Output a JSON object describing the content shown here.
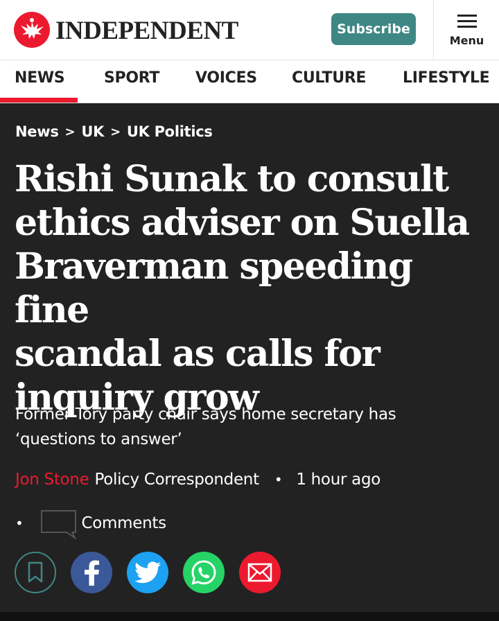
{
  "header": {
    "logo_text": "INDEPENDENT",
    "subscribe_label": "Subscribe",
    "menu_label": "Menu"
  },
  "nav": {
    "items": [
      {
        "label": "NEWS",
        "active": true
      },
      {
        "label": "SPORT"
      },
      {
        "label": "VOICES"
      },
      {
        "label": "CULTURE"
      },
      {
        "label": "LIFESTYLE"
      }
    ]
  },
  "breadcrumb": {
    "items": [
      "News",
      "UK",
      "UK Politics"
    ],
    "separator": ">"
  },
  "article": {
    "headline_lines": [
      "Rishi Sunak to consult",
      "ethics adviser on Suella",
      "Braverman speeding fine",
      "scandal as calls for",
      "inquiry grow"
    ],
    "standfirst_lines": [
      "Former Tory party chair says home secretary has",
      "‘questions to answer’"
    ],
    "author": "Jon Stone",
    "author_role": "Policy Correspondent",
    "timestamp": "1 hour ago",
    "comments_label": "Comments",
    "bullet": "•"
  },
  "share": {
    "buttons": [
      "bookmark",
      "facebook",
      "twitter",
      "whatsapp",
      "email"
    ]
  },
  "colors": {
    "accent_red": "#ec1a2e",
    "subscribe_teal": "#3f8784",
    "article_bg": "#222222",
    "facebook": "#3b5998",
    "twitter": "#1da1f2",
    "whatsapp": "#25d366"
  },
  "icons": {
    "logo": "eagle-logo-icon",
    "menu": "hamburger-icon",
    "comment": "comment-bubble-icon",
    "bookmark": "bookmark-icon",
    "facebook": "facebook-icon",
    "twitter": "twitter-bird-icon",
    "whatsapp": "whatsapp-icon",
    "email": "envelope-icon"
  }
}
